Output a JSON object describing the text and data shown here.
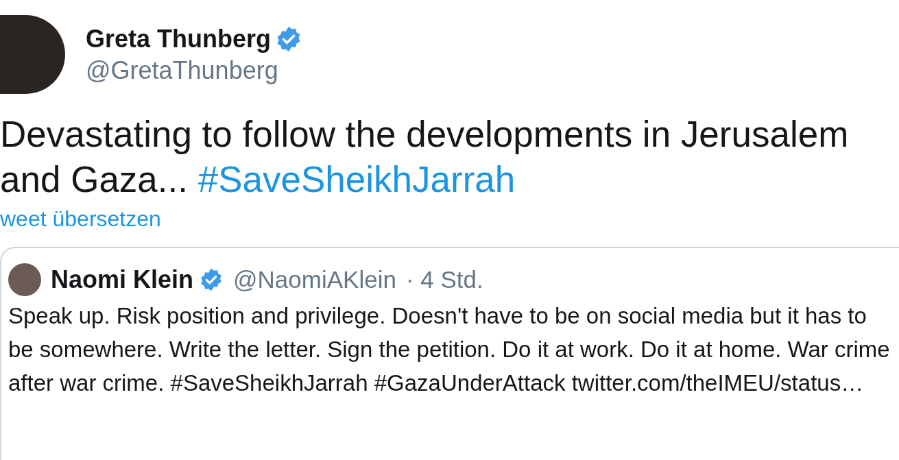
{
  "tweet": {
    "author": {
      "name": "Greta Thunberg",
      "handle": "@GretaThunberg",
      "verified": true
    },
    "text": [
      {
        "kind": "text",
        "text": "Devastating to follow the developments in Jerusalem and Gaza... "
      },
      {
        "kind": "hashtag",
        "text": "#SaveSheikhJarrah"
      }
    ],
    "translate_link": "weet übersetzen",
    "quoted_tweet": {
      "author": {
        "name": "Naomi Klein",
        "handle": "@NaomiAKlein",
        "verified": true
      },
      "time": "· 4 Std.",
      "text": [
        {
          "kind": "text",
          "text": "Speak up. Risk position and privilege. Doesn't have to be on social media but it has to be somewhere. Write the letter. Sign the petition. Do it at work. Do it at home. War crime after war crime. #SaveSheikhJarrah #GazaUnderAttack twitter.com/theIMEU/status…"
        }
      ]
    }
  }
}
